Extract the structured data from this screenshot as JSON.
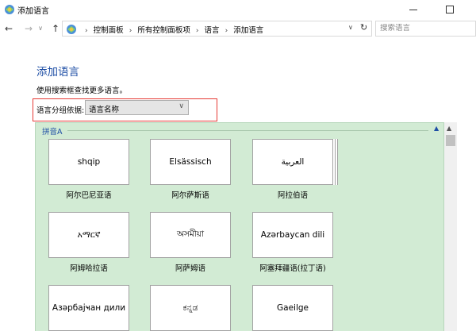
{
  "window": {
    "title": "添加语言"
  },
  "address": {
    "crumbs": [
      "控制面板",
      "所有控制面板项",
      "语言",
      "添加语言"
    ],
    "search_placeholder": "搜索语言"
  },
  "content": {
    "heading": "添加语言",
    "description": "使用搜索框查找更多语言。",
    "group_label": "语言分组依据:",
    "group_value": "语言名称"
  },
  "panel": {
    "header": "拼音A",
    "tiles": [
      {
        "native": "shqip",
        "label": "阿尔巴尼亚语"
      },
      {
        "native": "Elsässisch",
        "label": "阿尔萨斯语"
      },
      {
        "native": "العربية",
        "label": "阿拉伯语"
      },
      {
        "native": "አማርኛ",
        "label": "阿姆哈拉语"
      },
      {
        "native": "অসমীয়া",
        "label": "阿萨姆语"
      },
      {
        "native": "Azərbaycan dili",
        "label": "阿塞拜疆语(拉丁语)"
      },
      {
        "native": "Азәрбајҹан дили",
        "label": ""
      },
      {
        "native": "ಕನ್ನಡ",
        "label": ""
      },
      {
        "native": "Gaeilge",
        "label": ""
      }
    ]
  },
  "colors": {
    "accent": "#1e4ea5",
    "panel_bg": "#d2ebd4",
    "highlight_border": "#e53935"
  }
}
